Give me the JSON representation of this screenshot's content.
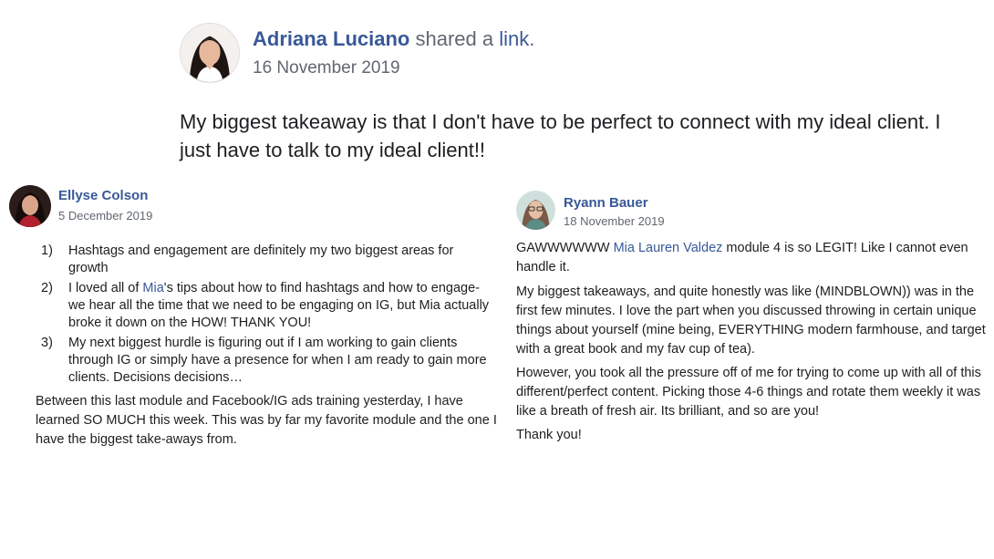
{
  "posts": {
    "top": {
      "author": "Adriana Luciano",
      "action_text": "shared a",
      "action_link": "link",
      "action_end": ".",
      "date": "16 November 2019",
      "body": "My biggest takeaway is that I don't have to be perfect to connect with my ideal client. I just have to talk to my ideal client!!"
    },
    "ellyse": {
      "author": "Ellyse Colson",
      "date": "5 December 2019",
      "items": [
        {
          "num": "1)",
          "text": "Hashtags and engagement are definitely my two biggest areas for growth"
        },
        {
          "num": "2)",
          "before": "I loved all of ",
          "mention": "Mia",
          "after": "'s tips about how to find hashtags and how to engage- we hear all the time that we need to be engaging on IG, but Mia actually broke it down on the HOW! THANK YOU!"
        },
        {
          "num": "3)",
          "text": "My next biggest hurdle is figuring out if I am working to gain clients through IG or simply have a presence for when I am ready to gain more clients. Decisions decisions…"
        }
      ],
      "closing": "Between this last module and Facebook/IG ads training yesterday, I have learned SO MUCH this week. This was by far my favorite module and the one I have the biggest take-aways from."
    },
    "ryann": {
      "author": "Ryann Bauer",
      "date": "18 November 2019",
      "p1_before": "GAWWWWWW ",
      "p1_mention": "Mia Lauren Valdez",
      "p1_after": " module 4 is so LEGIT! Like I cannot even handle it.",
      "p2": "My biggest takeaways, and quite honestly was like (MINDBLOWN)) was in the first few minutes. I love the part when you discussed throwing in certain unique things about yourself (mine being, EVERYTHING modern farmhouse, and target with a great book and my fav cup of tea).",
      "p3": "However, you took all the pressure off of me for trying to come up with all of this different/perfect content. Picking those 4-6 things and rotate them weekly it was like a breath of fresh air. Its brilliant, and so are you!",
      "p4": "Thank you!"
    }
  },
  "colors": {
    "link": "#385898",
    "meta": "#606770",
    "text": "#1c1e21"
  }
}
